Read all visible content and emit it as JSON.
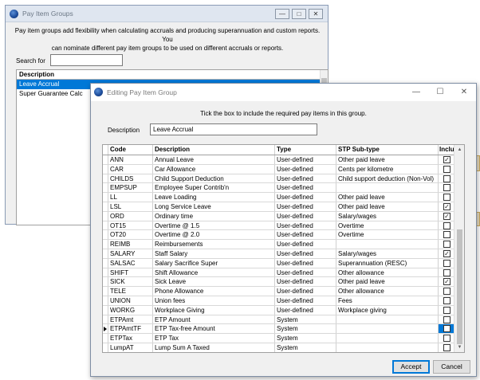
{
  "back_window": {
    "title": "Pay Item Groups",
    "titlebar_buttons": [
      "—",
      "□",
      "✕"
    ],
    "info_line1": "Pay item groups add flexibility when calculating accruals and producing superannuation and custom reports. You",
    "info_line2": "can nominate different pay item groups to be used on different accruals or reports.",
    "search_label": "Search for",
    "search_value": "",
    "list_header": "Description",
    "list_items": [
      "Leave Accrual",
      "Super Guarantee Calc"
    ]
  },
  "front_window": {
    "title": "Editing Pay Item Group",
    "sys_buttons": [
      "—",
      "☐",
      "✕"
    ],
    "info": "Tick the box to include the required pay items in this group.",
    "description_label": "Description",
    "description_value": "Leave Accrual",
    "columns": {
      "code": "Code",
      "description": "Description",
      "type": "Type",
      "stp": "STP Sub-type",
      "include": "Include"
    },
    "rows": [
      {
        "code": "ANN",
        "description": "Annual Leave",
        "type": "User-defined",
        "stp": "Other paid leave",
        "checked": true
      },
      {
        "code": "CAR",
        "description": "Car Allowance",
        "type": "User-defined",
        "stp": "Cents per kilometre",
        "checked": false
      },
      {
        "code": "CHILDS",
        "description": "Child Support Deduction",
        "type": "User-defined",
        "stp": "Child support deduction (Non-Vol)",
        "checked": false
      },
      {
        "code": "EMPSUP",
        "description": "Employee Super Contrib'n",
        "type": "User-defined",
        "stp": "",
        "checked": false
      },
      {
        "code": "LL",
        "description": "Leave Loading",
        "type": "User-defined",
        "stp": "Other paid leave",
        "checked": false
      },
      {
        "code": "LSL",
        "description": "Long Service Leave",
        "type": "User-defined",
        "stp": "Other paid leave",
        "checked": true
      },
      {
        "code": "ORD",
        "description": "Ordinary time",
        "type": "User-defined",
        "stp": "Salary/wages",
        "checked": true
      },
      {
        "code": "OT15",
        "description": "Overtime @ 1.5",
        "type": "User-defined",
        "stp": "Overtime",
        "checked": false
      },
      {
        "code": "OT20",
        "description": "Overtime @ 2.0",
        "type": "User-defined",
        "stp": "Overtime",
        "checked": false
      },
      {
        "code": "REIMB",
        "description": "Reimbursements",
        "type": "User-defined",
        "stp": "",
        "checked": false
      },
      {
        "code": "SALARY",
        "description": "Staff Salary",
        "type": "User-defined",
        "stp": "Salary/wages",
        "checked": true
      },
      {
        "code": "SALSAC",
        "description": "Salary Sacrifice Super",
        "type": "User-defined",
        "stp": "Superannuation (RESC)",
        "checked": false
      },
      {
        "code": "SHIFT",
        "description": "Shift Allowance",
        "type": "User-defined",
        "stp": "Other allowance",
        "checked": false
      },
      {
        "code": "SICK",
        "description": "Sick Leave",
        "type": "User-defined",
        "stp": "Other paid leave",
        "checked": true
      },
      {
        "code": "TELE",
        "description": "Phone Allowance",
        "type": "User-defined",
        "stp": "Other allowance",
        "checked": false
      },
      {
        "code": "UNION",
        "description": "Union fees",
        "type": "User-defined",
        "stp": "Fees",
        "checked": false
      },
      {
        "code": "WORKG",
        "description": "Workplace Giving",
        "type": "User-defined",
        "stp": "Workplace giving",
        "checked": false
      },
      {
        "code": "ETPAmt",
        "description": "ETP Amount",
        "type": "System",
        "stp": "",
        "checked": false
      },
      {
        "code": "ETPAmtTF",
        "description": "ETP Tax-free Amount",
        "type": "System",
        "stp": "",
        "checked": false,
        "current": true
      },
      {
        "code": "ETPTax",
        "description": "ETP Tax",
        "type": "System",
        "stp": "",
        "checked": false
      },
      {
        "code": "LumpAT",
        "description": "Lump Sum A Taxed",
        "type": "System",
        "stp": "",
        "checked": false
      }
    ],
    "accept_label": "Accept",
    "cancel_label": "Cancel"
  },
  "colors": {
    "selection": "#0078d7",
    "window_bg": "#f0f0f0",
    "edge_button": "#e8dcc0"
  }
}
